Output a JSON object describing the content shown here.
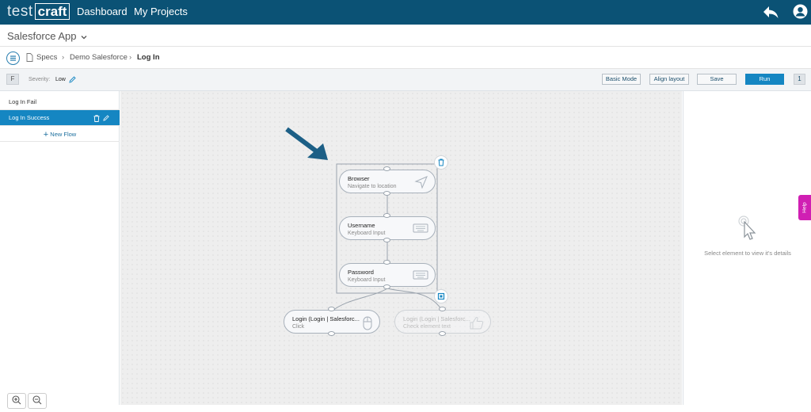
{
  "header": {
    "logo_part1": "test",
    "logo_part2": "craft",
    "nav": [
      "Dashboard",
      "My Projects"
    ],
    "icons": [
      "reply-icon",
      "user-icon"
    ]
  },
  "app": {
    "name": "Salesforce App"
  },
  "breadcrumb": {
    "items": [
      "Specs",
      "Demo Salesforce"
    ],
    "current": "Log In"
  },
  "toolbar": {
    "flow_badge": "F",
    "severity_label": "Severity:",
    "severity_value": "Low",
    "basic_mode": "Basic Mode",
    "align_layout": "Align layout",
    "save": "Save",
    "run": "Run",
    "counter": "1"
  },
  "flows": {
    "items": [
      "Log In Fail",
      "Log In Success"
    ],
    "selected": "Log In Success",
    "new_flow": "New Flow"
  },
  "canvas": {
    "nodes": [
      {
        "title": "Browser",
        "subtitle": "Navigate to location",
        "icon": "navigate-icon"
      },
      {
        "title": "Username",
        "subtitle": "Keyboard Input",
        "icon": "keyboard-icon"
      },
      {
        "title": "Password",
        "subtitle": "Keyboard Input",
        "icon": "keyboard-icon"
      },
      {
        "title": "Login (Login | Salesforc...",
        "subtitle": "Click",
        "icon": "mouse-icon"
      },
      {
        "title": "Login (Login | Salesforc...",
        "subtitle": "Check element text",
        "icon": "thumbs-up-icon"
      }
    ]
  },
  "details": {
    "empty_message": "Select element to view it's details"
  },
  "help": {
    "label": "Help"
  },
  "colors": {
    "header": "#0b5275",
    "accent": "#1586c2",
    "help": "#d01fb3",
    "arrow": "#1c5f86"
  }
}
